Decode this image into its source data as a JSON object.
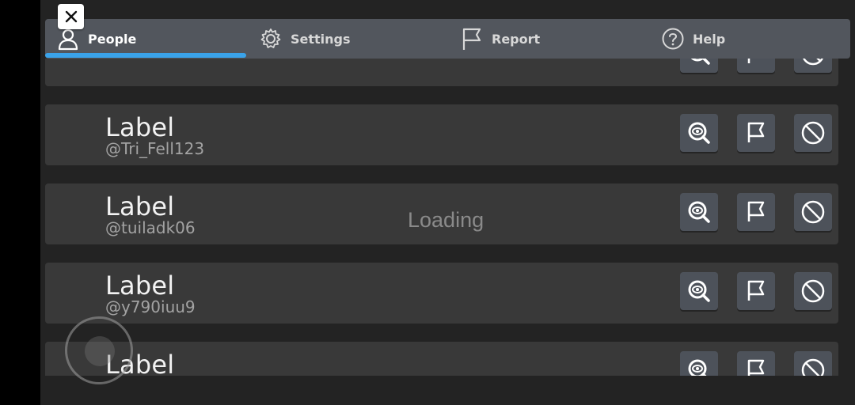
{
  "tabs": [
    {
      "label": "People",
      "icon": "person-icon",
      "active": true
    },
    {
      "label": "Settings",
      "icon": "gear-icon",
      "active": false
    },
    {
      "label": "Report",
      "icon": "flag-icon",
      "active": false
    },
    {
      "label": "Help",
      "icon": "question-icon",
      "active": false
    }
  ],
  "players": [
    {
      "name": "",
      "handle": ""
    },
    {
      "name": "Label",
      "handle": "@Tri_Fell123"
    },
    {
      "name": "Label",
      "handle": "@tuiladk06"
    },
    {
      "name": "Label",
      "handle": "@y790iuu9"
    },
    {
      "name": "Label",
      "handle": ""
    }
  ],
  "row_actions": [
    "inspect-icon",
    "flag-icon",
    "block-icon"
  ],
  "loading_text": "Loading",
  "colors": {
    "accent": "#3aa3ea",
    "panel": "#393939",
    "tabbar": "#52565d",
    "background": "#232323"
  }
}
